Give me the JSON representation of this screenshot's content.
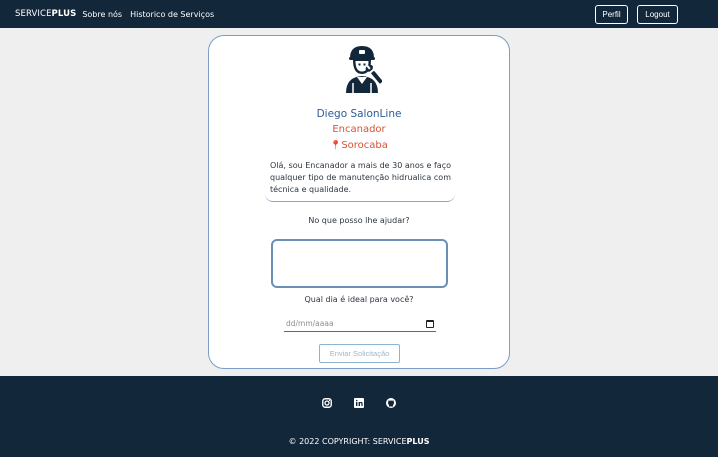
{
  "nav": {
    "brand_prefix": "SERVICE",
    "brand_suffix": "PLUS",
    "links": [
      "Sobre nós",
      "Historico de Serviços"
    ],
    "perfil": "Perfil",
    "logout": "Logout"
  },
  "profile": {
    "name": "Diego SalonLine",
    "role": "Encanador",
    "city": "Sorocaba",
    "bio": "Olá, sou Encanador a mais de 30 anos e faço qualquer tipo de manutenção hidrualica com técnica e qualidade."
  },
  "form": {
    "help_label": "No que posso lhe ajudar?",
    "day_label": "Qual dia é ideal para você?",
    "date_placeholder": "dd/mm/aaaa",
    "submit": "Enviar Solicitação"
  },
  "footer": {
    "copyright_prefix": "© 2022 COPYRIGHT: SERVICE",
    "copyright_suffix": "PLUS",
    "social_icons": [
      "instagram-icon",
      "linkedin-icon",
      "github-icon"
    ]
  },
  "colors": {
    "navy": "#13273a",
    "accent_blue": "#2d5b93",
    "accent_red": "#d4533a"
  }
}
